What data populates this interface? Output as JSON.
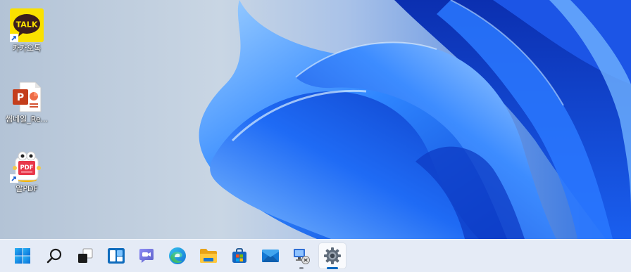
{
  "desktop": {
    "icons": [
      {
        "label": "카카오톡",
        "icon": "kakaotalk-icon",
        "badge": "TALK",
        "shortcut": true
      },
      {
        "label": "썸네일_Re...",
        "icon": "powerpoint-file-icon",
        "badge": "P",
        "shortcut": false
      },
      {
        "label": "알PDF",
        "icon": "alpdf-icon",
        "badge": "PDF",
        "shortcut": true
      }
    ]
  },
  "taskbar": {
    "items": [
      {
        "name": "start-button",
        "icon": "windows-logo-icon"
      },
      {
        "name": "search-button",
        "icon": "search-icon"
      },
      {
        "name": "task-view-button",
        "icon": "task-view-icon"
      },
      {
        "name": "widgets-button",
        "icon": "widgets-icon"
      },
      {
        "name": "teams-chat-button",
        "icon": "chat-icon"
      },
      {
        "name": "edge-button",
        "icon": "edge-icon"
      },
      {
        "name": "file-explorer-button",
        "icon": "folder-icon"
      },
      {
        "name": "microsoft-store-button",
        "icon": "store-icon"
      },
      {
        "name": "mail-button",
        "icon": "mail-icon"
      },
      {
        "name": "remote-desktop-button",
        "icon": "remote-desktop-icon",
        "running": true
      },
      {
        "name": "settings-button",
        "icon": "gear-icon",
        "running": true,
        "active": true
      }
    ]
  },
  "colors": {
    "accent": "#0067c0",
    "kakao_yellow": "#fae100",
    "powerpoint_red": "#c43e1c",
    "pdf_red": "#e8374a",
    "taskbar_bg": "#e8eef7"
  }
}
